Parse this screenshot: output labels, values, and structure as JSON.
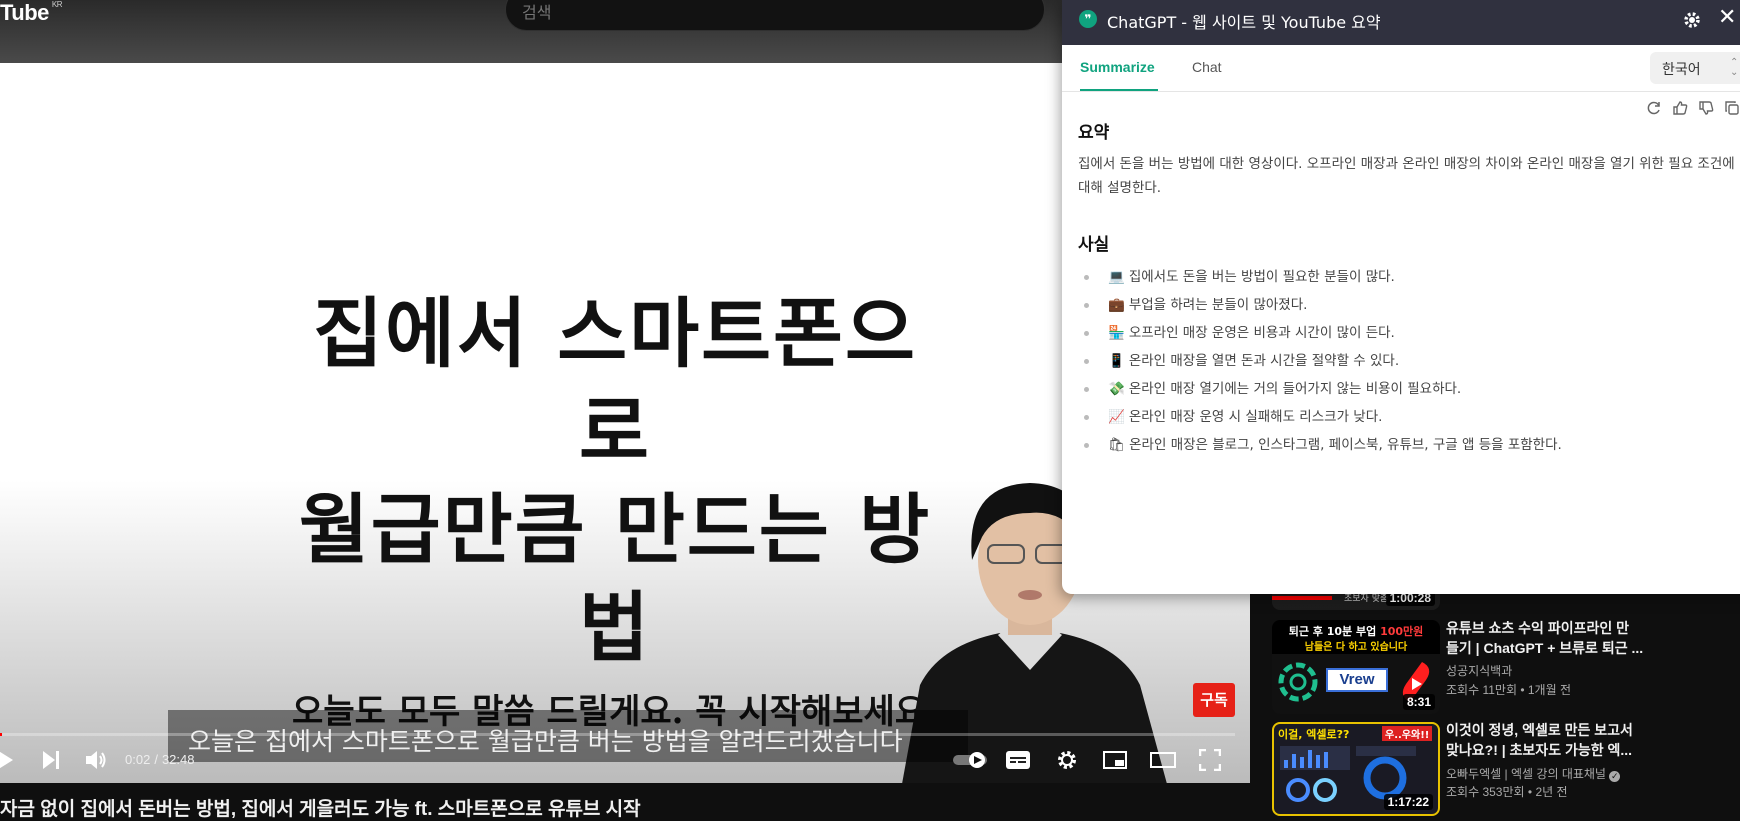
{
  "youtube": {
    "logo": "Tube",
    "region": "KR",
    "search_placeholder": "검색"
  },
  "video": {
    "title_line1": "집에서 스마트폰으로",
    "title_line2": "월급만큼 만드는 방법",
    "title_line3": "오늘도 모두 말씀 드릴게요. 꼭 시작해보세요.",
    "subscribe_badge": "구독",
    "caption": "오늘은 집에서 스마트폰으로 월급만큼 버는 방법을 알려드리겠습니다",
    "time_current": "0:02",
    "time_total": "32:48",
    "progress": 0.001,
    "heading": "자금 없이 집에서 돈버는 방법, 집에서 게을러도 가능 ft. 스마트폰으로 유튜브 시작"
  },
  "recommendations": [
    {
      "duration": "1:00:28",
      "thumb_text": "초보자 맞춤"
    },
    {
      "duration": "8:31",
      "thumb_top": "퇴근 후 10분 부업",
      "thumb_highlight": "100만원",
      "thumb_bottom": "남들은 다 하고 있습니다",
      "thumb_label": "Vrew",
      "title_line1": "유튜브 쇼츠 수익 파이프라인 만",
      "title_line2": "들기 | ChatGPT + 브류로 퇴근 ...",
      "channel": "성공지식백과",
      "views": "조회수 11만회",
      "age": "1개월 전"
    },
    {
      "duration": "1:17:22",
      "thumb_text": "이걸, 엑셀로??",
      "thumb_badge": "우..우와!!",
      "title_line1": "이것이 정녕, 엑셀로 만든 보고서",
      "title_line2": "맞나요?! | 초보자도 가능한 엑...",
      "channel": "오빠두엑셀 | 엑셀 강의 대표채널",
      "views": "조회수 353만회",
      "age": "2년 전"
    }
  ],
  "extension": {
    "title": "ChatGPT - 웹 사이트 및 YouTube 요약",
    "tabs": [
      "Summarize",
      "Chat"
    ],
    "language": "한국어",
    "summary_heading": "요약",
    "summary_text": "집에서 돈을 버는 방법에 대한 영상이다. 오프라인 매장과 온라인 매장의 차이와 온라인 매장을 열기 위한 필요 조건에 대해 설명한다.",
    "facts_heading": "사실",
    "facts": [
      {
        "emoji": "💻",
        "text": "집에서도 돈을 버는 방법이 필요한 분들이 많다."
      },
      {
        "emoji": "💼",
        "text": "부업을 하려는 분들이 많아졌다."
      },
      {
        "emoji": "🏪",
        "text": "오프라인 매장 운영은 비용과 시간이 많이 든다."
      },
      {
        "emoji": "📱",
        "text": "온라인 매장을 열면 돈과 시간을 절약할 수 있다."
      },
      {
        "emoji": "💸",
        "text": "온라인 매장 열기에는 거의 들어가지 않는 비용이 필요하다."
      },
      {
        "emoji": "📈",
        "text": "온라인 매장 운영 시 실패해도 리스크가 낮다."
      },
      {
        "emoji": "🛍",
        "text": "온라인 매장은 블로그, 인스타그램, 페이스북, 유튜브, 구글 앱 등을 포함한다."
      }
    ]
  },
  "colors": {
    "accent_green": "#10a37f",
    "header_dark": "#30313f",
    "youtube_red": "#ff0000"
  }
}
